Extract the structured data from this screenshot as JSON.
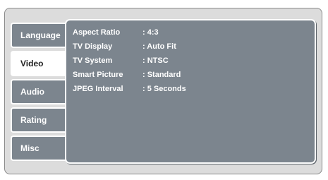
{
  "tabs": [
    {
      "label": "Language",
      "active": false
    },
    {
      "label": "Video",
      "active": true
    },
    {
      "label": "Audio",
      "active": false
    },
    {
      "label": "Rating",
      "active": false
    },
    {
      "label": "Misc",
      "active": false
    }
  ],
  "settings": [
    {
      "label": "Aspect Ratio",
      "value": ": 4:3"
    },
    {
      "label": "TV Display",
      "value": ": Auto Fit"
    },
    {
      "label": "TV System",
      "value": ": NTSC"
    },
    {
      "label": "Smart Picture",
      "value": ": Standard"
    },
    {
      "label": "JPEG Interval",
      "value": ": 5 Seconds"
    }
  ],
  "colors": {
    "panel": "#7c858e",
    "frame": "#dcdcdc",
    "active_tab": "#ffffff",
    "text": "#ffffff"
  }
}
